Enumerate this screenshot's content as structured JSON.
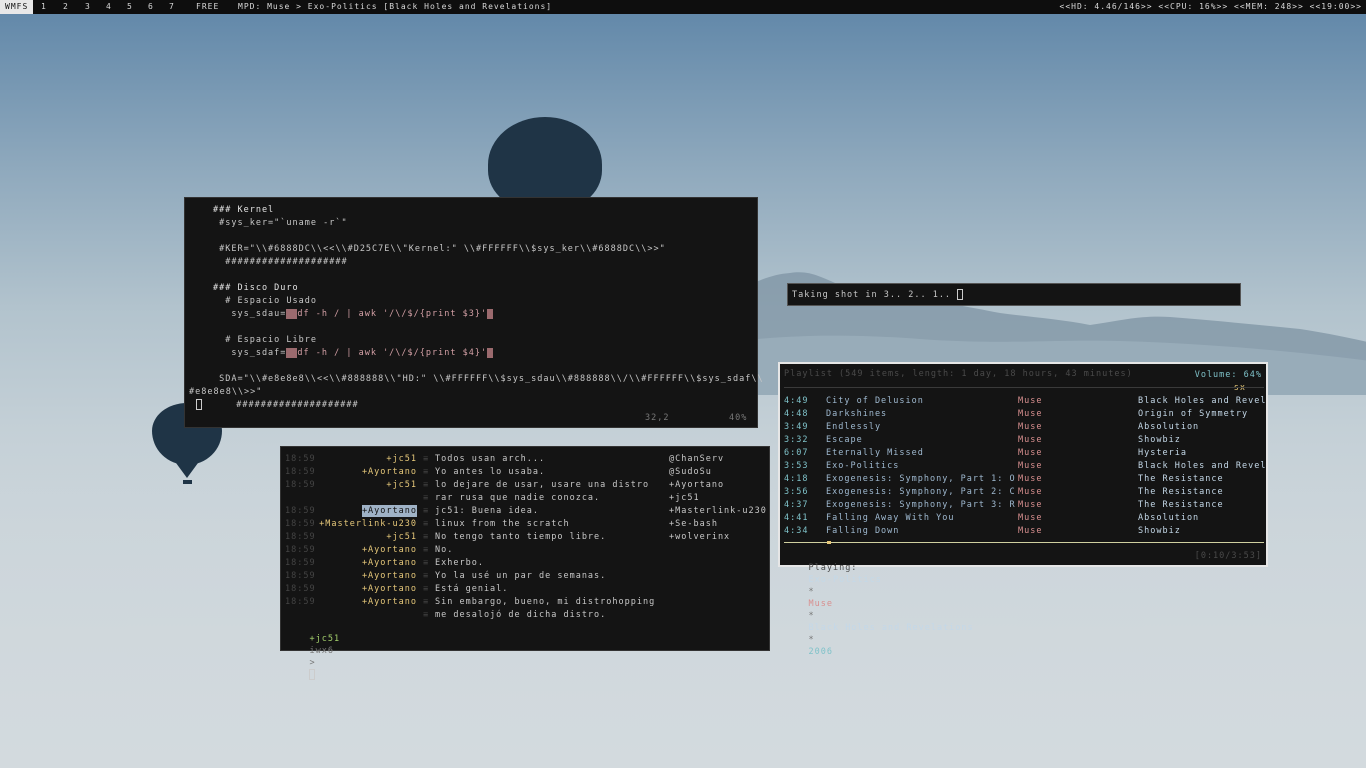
{
  "topbar": {
    "wm_name": "WMFS",
    "workspaces": [
      "1",
      "2",
      "3",
      "4",
      "5",
      "6",
      "7"
    ],
    "free_label": "FREE",
    "mpd": "MPD: Muse > Exo-Politics [Black Holes and Revelations]",
    "hd": "<<HD: 4.46/146>>",
    "cpu": "<<CPU: 16%>>",
    "mem": "<<MEM: 248>>",
    "clock": "<<19:00>>"
  },
  "editor": {
    "l1": "### Kernel",
    "l2": " #sys_ker=\"`uname -r`\"",
    "l3": " #KER=\"\\\\#6888DC\\\\<<\\\\#D25C7E\\\\\"Kernel:\" \\\\#FFFFFF\\\\$sys_ker\\\\#6888DC\\\\>>\"",
    "l4": "  ####################",
    "l5": "### Disco Duro",
    "l6": "  # Espacio Usado",
    "l7a": "   sys_sdau=",
    "l7b": "df -h / | awk '/\\/$/{print $3}'",
    "l8": "  # Espacio Libre",
    "l9a": "   sys_sdaf=",
    "l9b": "df -h / | awk '/\\/$/{print $4}'",
    "l10": " SDA=\"\\\\#e8e8e8\\\\<<\\\\#888888\\\\\"HD:\" \\\\#FFFFFF\\\\$sys_sdau\\\\#888888\\\\/\\\\#FFFFFF\\\\$sys_sdaf\\\\",
    "l11": "#e8e8e8\\\\>>\"",
    "l12": "  ####################",
    "status_pos": "32,2",
    "status_pct": "40%"
  },
  "prompt": {
    "text": "Taking shot in 3.. 2.. 1.. "
  },
  "irc": {
    "messages": [
      {
        "time": "18:59",
        "nick": "+jc51",
        "text": "Todos usan arch..."
      },
      {
        "time": "18:59",
        "nick": "+Ayortano",
        "text": "Yo antes lo usaba."
      },
      {
        "time": "18:59",
        "nick": "+jc51",
        "text": "lo dejare de usar, usare una distro"
      },
      {
        "time": "",
        "nick": "",
        "text": "rar rusa que nadie conozca."
      },
      {
        "time": "18:59",
        "nick": "+Ayortano",
        "text": "jc51: Buena idea."
      },
      {
        "time": "18:59",
        "nick": "+Masterlink-u230",
        "text": "linux from the scratch"
      },
      {
        "time": "18:59",
        "nick": "+jc51",
        "text": "No tengo tanto tiempo libre."
      },
      {
        "time": "18:59",
        "nick": "+Ayortano",
        "text": "No."
      },
      {
        "time": "18:59",
        "nick": "+Ayortano",
        "text": "Exherbo."
      },
      {
        "time": "18:59",
        "nick": "+Ayortano",
        "text": "Yo la usé un par de semanas."
      },
      {
        "time": "18:59",
        "nick": "+Ayortano",
        "text": "Está genial."
      },
      {
        "time": "18:59",
        "nick": "+Ayortano",
        "text": "Sin embargo, bueno, mi distrohopping"
      },
      {
        "time": "",
        "nick": "",
        "text": "me desalojó de dicha distro."
      }
    ],
    "users": [
      "@ChanServ",
      "@SudoSu",
      "+Ayortano",
      "+jc51",
      "+Masterlink-u230",
      "+Se-bash",
      "+wolverinx"
    ],
    "input_nick": "+jc51",
    "input_chan": "iwx6",
    "input_sep": ">"
  },
  "mpd": {
    "header": "Playlist (549 items, length: 1 day, 18 hours, 43 minutes)",
    "volume": "Volume: 64%",
    "flags": "sx",
    "rows": [
      {
        "len": "4:49",
        "title": "City of Delusion",
        "artist": "Muse",
        "album": "Black Holes and Revel"
      },
      {
        "len": "4:48",
        "title": "Darkshines",
        "artist": "Muse",
        "album": "Origin of Symmetry"
      },
      {
        "len": "3:49",
        "title": "Endlessly",
        "artist": "Muse",
        "album": "Absolution"
      },
      {
        "len": "3:32",
        "title": "Escape",
        "artist": "Muse",
        "album": "Showbiz"
      },
      {
        "len": "6:07",
        "title": "Eternally Missed",
        "artist": "Muse",
        "album": "Hysteria"
      },
      {
        "len": "3:53",
        "title": "Exo-Politics",
        "artist": "Muse",
        "album": "Black Holes and Revel"
      },
      {
        "len": "4:18",
        "title": "Exogenesis: Symphony, Part 1: O",
        "artist": "Muse",
        "album": "The Resistance"
      },
      {
        "len": "3:56",
        "title": "Exogenesis: Symphony, Part 2: C",
        "artist": "Muse",
        "album": "The Resistance"
      },
      {
        "len": "4:37",
        "title": "Exogenesis: Symphony, Part 3: R",
        "artist": "Muse",
        "album": "The Resistance"
      },
      {
        "len": "4:41",
        "title": "Falling Away With You",
        "artist": "Muse",
        "album": "Absolution"
      },
      {
        "len": "4:34",
        "title": "Falling Down",
        "artist": "Muse",
        "album": "Showbiz"
      }
    ],
    "now_label": "Playing:",
    "now_title": "Exo-Politics",
    "now_artist": "Muse",
    "now_album": "Black Holes and Revelations",
    "now_year": "2006",
    "now_dot": "*",
    "now_time": "[0:10/3:53]",
    "progress": 0.09
  },
  "colors": {
    "accent_blue": "#6888DC",
    "accent_pink": "#D25C7E",
    "bg": "#141414"
  }
}
